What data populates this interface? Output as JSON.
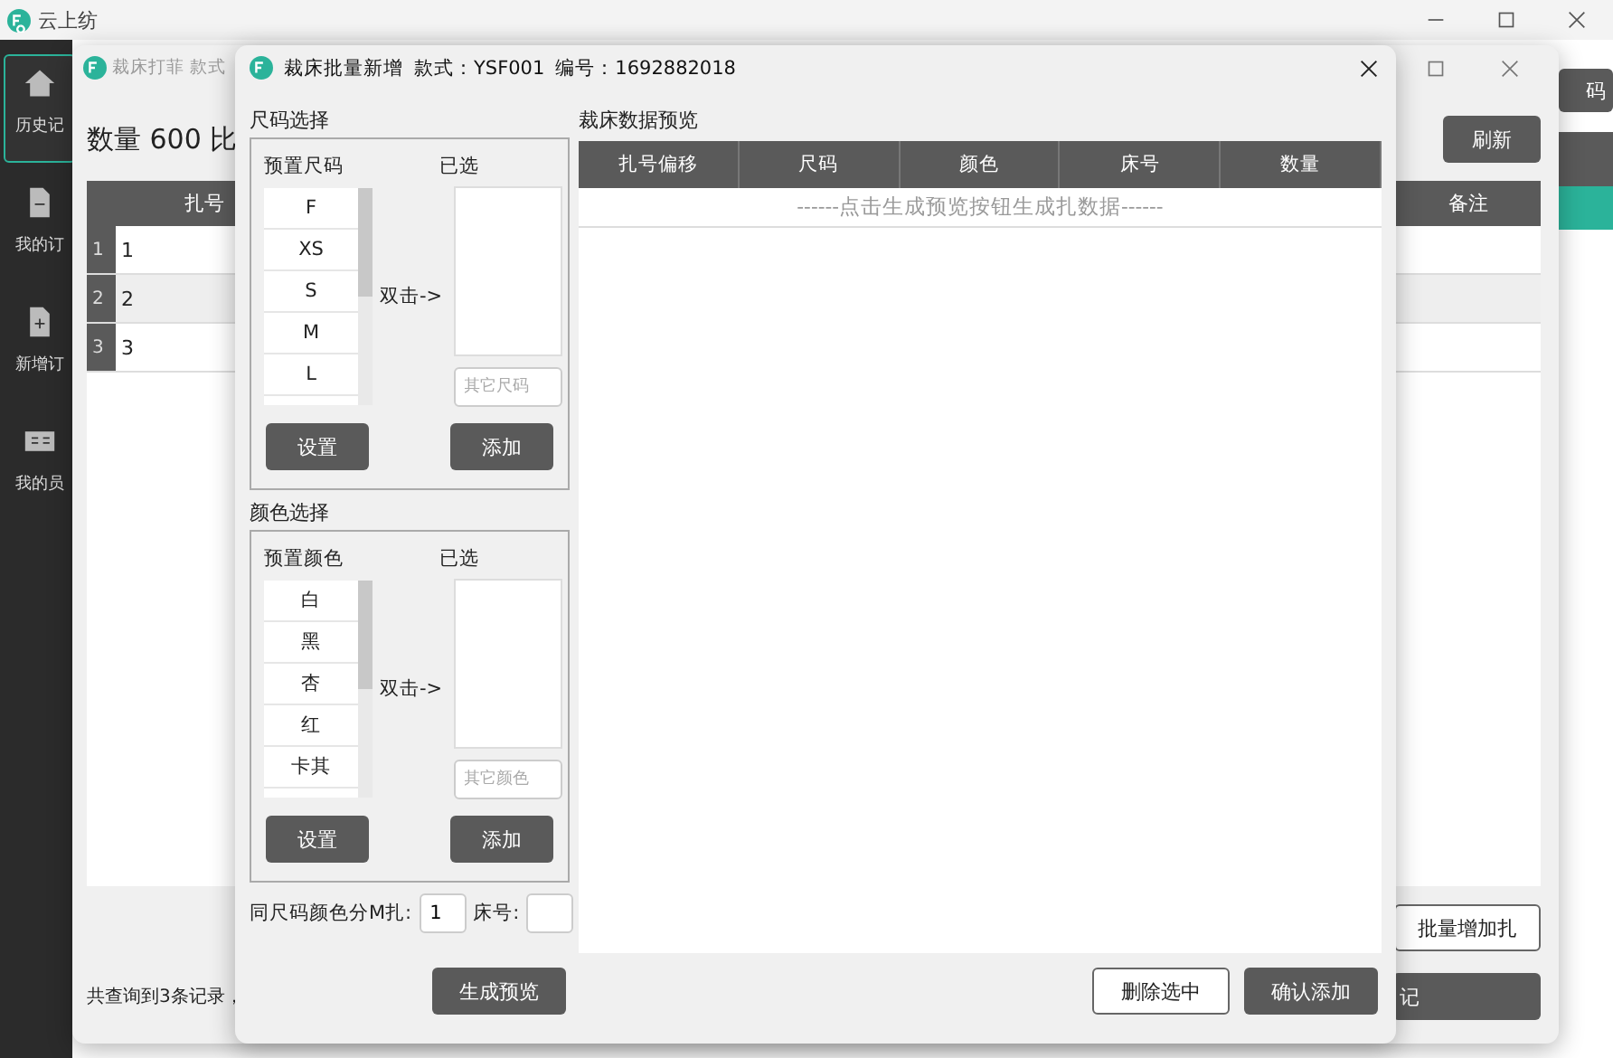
{
  "app": {
    "title": "云上纺",
    "sidebar": [
      {
        "label": "历史记",
        "selected": true
      },
      {
        "label": "我的订",
        "selected": false
      },
      {
        "label": "新增订",
        "selected": false
      },
      {
        "label": "我的员",
        "selected": false
      }
    ],
    "side_button": "码"
  },
  "order_window": {
    "title": "裁床打菲",
    "title_field": "款式",
    "summary": "数量 600  比",
    "refresh_button": "刷新",
    "table": {
      "columns": [
        "扎号",
        "备注"
      ],
      "rows": [
        {
          "index": "1",
          "column_1": "1"
        },
        {
          "index": "2",
          "column_1": "2"
        },
        {
          "index": "3",
          "column_1": "3"
        }
      ]
    },
    "batch_button": "批量增加扎",
    "register_button": "记",
    "footer": "共查询到3条记录，"
  },
  "dialog": {
    "title": "裁床批量新增",
    "style_label": "款式：YSF001",
    "number_label": "编号：1692882018",
    "groups": [
      {
        "title": "尺码选择",
        "preset_label": "预置尺码",
        "selected_label": "已选",
        "presets": [
          "F",
          "XS",
          "S",
          "M",
          "L"
        ],
        "hint": "双击->",
        "placeholder": "其它尺码",
        "set_button": "设置",
        "add_button": "添加"
      },
      {
        "title": "颜色选择",
        "preset_label": "预置颜色",
        "selected_label": "已选",
        "presets": [
          "白",
          "黑",
          "杏",
          "红",
          "卡其"
        ],
        "hint": "双击->",
        "placeholder": "其它颜色",
        "set_button": "设置",
        "add_button": "添加"
      }
    ],
    "split_label": "同尺码颜色分M扎:",
    "split_value": "1",
    "bed_label": "床号:",
    "preview_button": "生成预览",
    "preview_title": "裁床数据预览",
    "preview_columns": [
      "扎号偏移",
      "尺码",
      "颜色",
      "床号",
      "数量"
    ],
    "preview_placeholder": "------点击生成预览按钮生成扎数据------",
    "delete_button": "删除选中",
    "confirm_button": "确认添加"
  }
}
